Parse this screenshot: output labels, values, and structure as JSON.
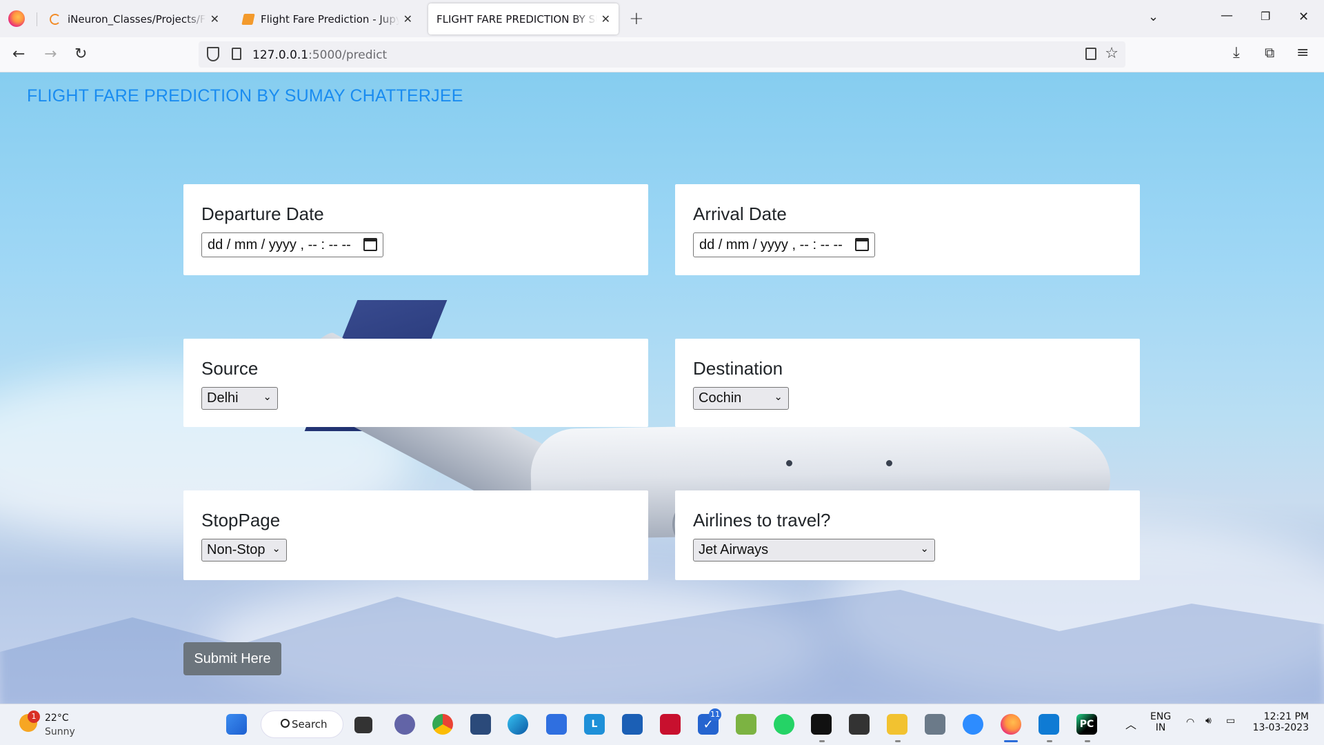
{
  "browser": {
    "tabs": [
      {
        "label": "iNeuron_Classes/Projects/Flight",
        "icon": "loading-spinner-icon"
      },
      {
        "label": "Flight Fare Prediction - Jupyter N",
        "icon": "jupyter-notebook-icon"
      },
      {
        "label": "FLIGHT FARE PREDICTION BY SUMAY",
        "icon": "",
        "active": true
      }
    ],
    "close_glyph": "✕",
    "new_tab_glyph": "+",
    "url_host": "127.0.0.1",
    "url_path": ":5000/predict"
  },
  "page": {
    "title": "FLIGHT FARE PREDICTION BY SUMAY CHATTERJEE",
    "departure": {
      "label": "Departure Date",
      "value": "dd / mm / yyyy ,  -- : --   --"
    },
    "arrival": {
      "label": "Arrival Date",
      "value": "dd / mm / yyyy ,  -- : --   --"
    },
    "source": {
      "label": "Source",
      "selected": "Delhi"
    },
    "destination": {
      "label": "Destination",
      "selected": "Cochin"
    },
    "stoppage": {
      "label": "StopPage",
      "selected": "Non-Stop"
    },
    "airline": {
      "label": "Airlines to travel?",
      "selected": "Jet Airways"
    },
    "submit_label": "Submit Here"
  },
  "taskbar": {
    "weather_temp": "22°C",
    "weather_desc": "Sunny",
    "weather_badge": "1",
    "search_label": "Search",
    "todo_badge": "11",
    "lang_line1": "ENG",
    "lang_line2": "IN",
    "time": "12:21 PM",
    "date": "13-03-2023"
  },
  "colors": {
    "title_blue": "#1a8cf0",
    "submit_gray": "#6c757d",
    "sky": "#9fd7f5"
  }
}
